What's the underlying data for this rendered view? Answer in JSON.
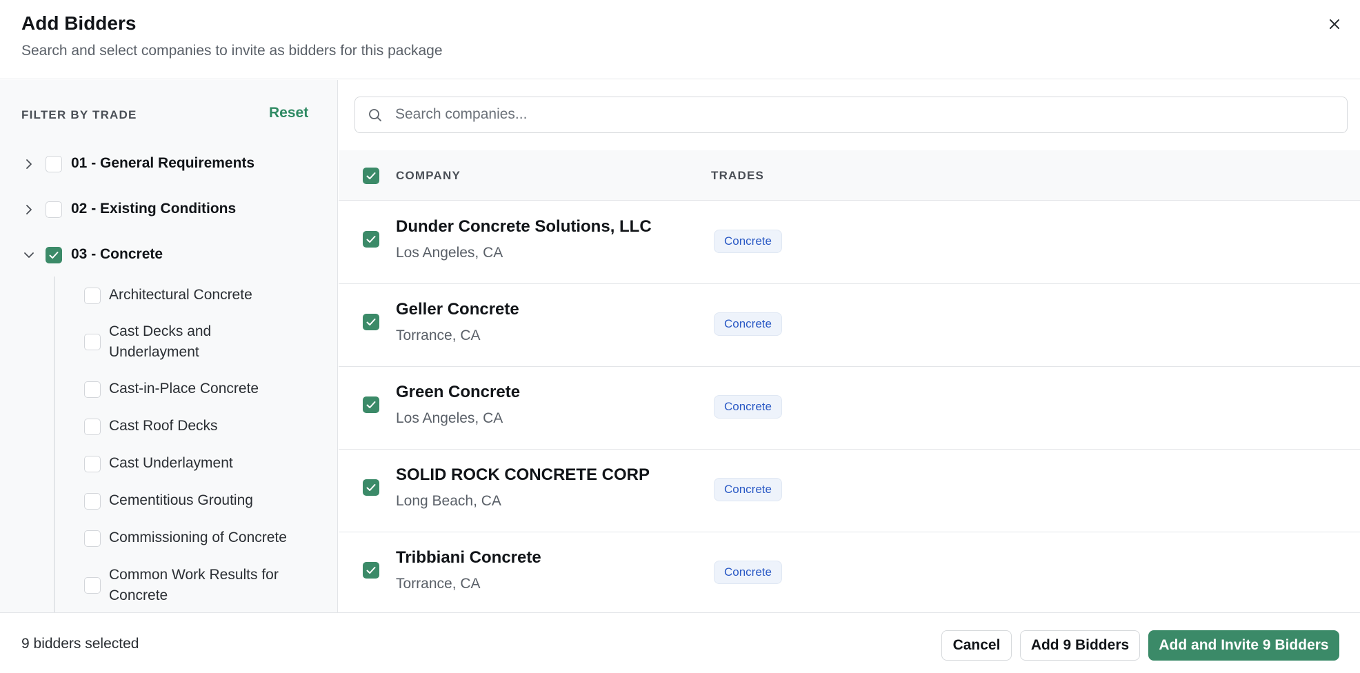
{
  "header": {
    "title": "Add Bidders",
    "subtitle": "Search and select companies to invite as bidders for this package"
  },
  "sidebar": {
    "filter_title": "FILTER BY TRADE",
    "reset_label": "Reset",
    "trades": [
      {
        "label": "01 - General Requirements",
        "checked": false,
        "expanded": false
      },
      {
        "label": "02 - Existing Conditions",
        "checked": false,
        "expanded": false
      },
      {
        "label": "03 - Concrete",
        "checked": true,
        "expanded": true
      }
    ],
    "subtrades": [
      {
        "label": "Architectural Concrete",
        "checked": false
      },
      {
        "label": "Cast Decks and Underlayment",
        "checked": false
      },
      {
        "label": "Cast-in-Place Concrete",
        "checked": false
      },
      {
        "label": "Cast Roof Decks",
        "checked": false
      },
      {
        "label": "Cast Underlayment",
        "checked": false
      },
      {
        "label": "Cementitious Grouting",
        "checked": false
      },
      {
        "label": "Commissioning of Concrete",
        "checked": false
      },
      {
        "label": "Common Work Results for Concrete",
        "checked": false
      }
    ]
  },
  "search": {
    "placeholder": "Search companies..."
  },
  "table": {
    "columns": [
      "COMPANY",
      "TRADES"
    ],
    "all_checked": true,
    "rows": [
      {
        "name": "Dunder Concrete Solutions, LLC",
        "location": "Los Angeles, CA",
        "trade": "Concrete",
        "checked": true
      },
      {
        "name": "Geller Concrete",
        "location": "Torrance, CA",
        "trade": "Concrete",
        "checked": true
      },
      {
        "name": "Green Concrete",
        "location": "Los Angeles, CA",
        "trade": "Concrete",
        "checked": true
      },
      {
        "name": "SOLID ROCK CONCRETE CORP",
        "location": "Long Beach, CA",
        "trade": "Concrete",
        "checked": true
      },
      {
        "name": "Tribbiani Concrete",
        "location": "Torrance, CA",
        "trade": "Concrete",
        "checked": true
      }
    ]
  },
  "footer": {
    "selected_count": "9 bidders selected",
    "cancel_label": "Cancel",
    "add_label": "Add 9 Bidders",
    "add_invite_label": "Add and Invite 9 Bidders"
  },
  "colors": {
    "accent": "#3b8a68",
    "badge_text": "#2a59c5",
    "badge_bg": "#eef3fb"
  }
}
